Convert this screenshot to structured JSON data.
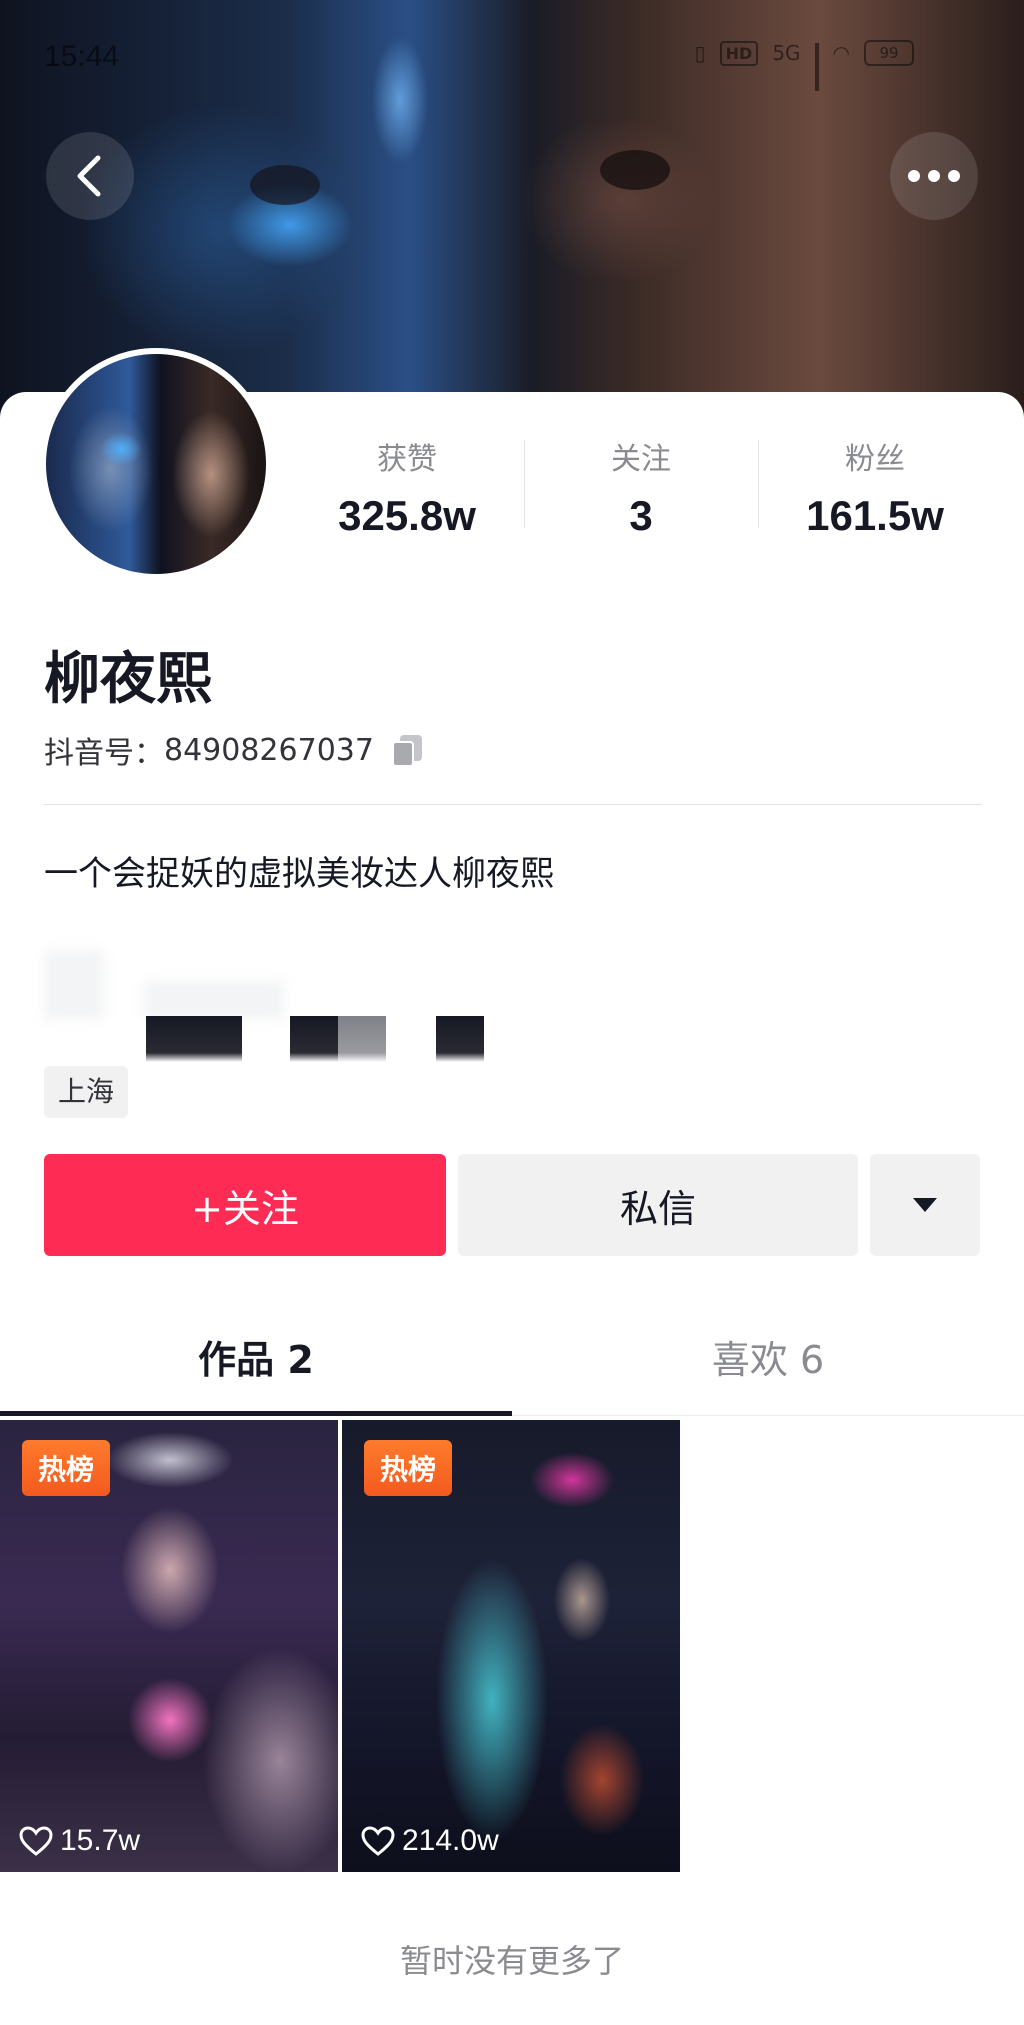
{
  "status_bar": {
    "time": "15:44",
    "network": "5G",
    "hd": "HD",
    "battery": "99"
  },
  "profile": {
    "nickname": "柳夜熙",
    "douyin_id_label": "抖音号：",
    "douyin_id": "84908267037",
    "bio": "一个会捉妖的虚拟美妆达人柳夜熙",
    "location": "上海"
  },
  "stats": [
    {
      "label": "获赞",
      "value": "325.8w"
    },
    {
      "label": "关注",
      "value": "3"
    },
    {
      "label": "粉丝",
      "value": "161.5w"
    }
  ],
  "actions": {
    "follow_label": "+关注",
    "message_label": "私信"
  },
  "tabs": [
    {
      "label": "作品 2",
      "active": true
    },
    {
      "label": "喜欢 6",
      "active": false
    }
  ],
  "videos": [
    {
      "badge": "热榜",
      "likes": "15.7w"
    },
    {
      "badge": "热榜",
      "likes": "214.0w"
    }
  ],
  "footer": {
    "no_more": "暂时没有更多了"
  },
  "colors": {
    "accent": "#fe2c55",
    "badge": "#f35a1e",
    "text_primary": "#161823",
    "text_secondary": "#8a8b91"
  },
  "icons": [
    "back-arrow-icon",
    "more-dots-icon",
    "copy-icon",
    "dropdown-triangle-icon",
    "heart-icon"
  ]
}
